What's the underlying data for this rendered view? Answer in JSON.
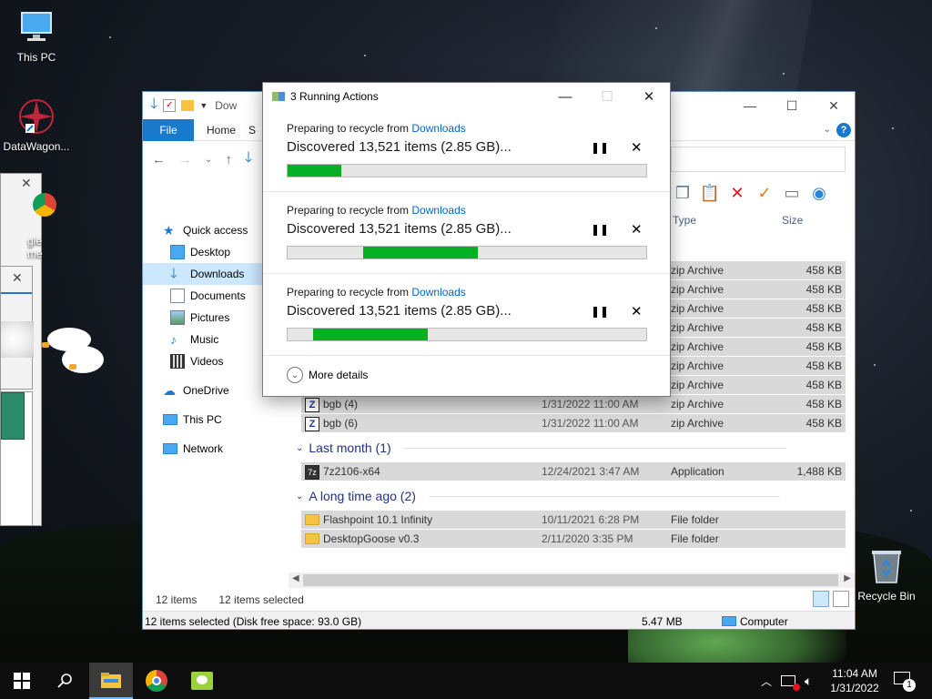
{
  "desktop": {
    "icons": [
      {
        "label": "This PC",
        "icon": "monitor-icon"
      },
      {
        "label": "DataWagon...",
        "icon": "app-icon"
      },
      {
        "label": "Recycle Bin",
        "icon": "recycle-bin-icon"
      }
    ],
    "partial_icon_label": "gle\nme"
  },
  "explorer": {
    "title": "Dow",
    "ribbon": {
      "file": "File",
      "home": "Home",
      "share": "S"
    },
    "nav": {
      "quick_access": "Quick access",
      "desktop": "Desktop",
      "downloads": "Downloads",
      "documents": "Documents",
      "pictures": "Pictures",
      "music": "Music",
      "videos": "Videos",
      "onedrive": "OneDrive",
      "this_pc": "This PC",
      "network": "Network"
    },
    "columns": {
      "type": "Type",
      "size": "Size"
    },
    "rows_top": [
      {
        "type": "zip Archive",
        "size": "458 KB"
      },
      {
        "type": "zip Archive",
        "size": "458 KB"
      },
      {
        "type": "zip Archive",
        "size": "458 KB"
      },
      {
        "type": "zip Archive",
        "size": "458 KB"
      },
      {
        "type": "zip Archive",
        "size": "458 KB"
      },
      {
        "type": "zip Archive",
        "size": "458 KB"
      },
      {
        "type": "zip Archive",
        "size": "458 KB"
      }
    ],
    "rows_named": [
      {
        "name": "bgb (4)",
        "date": "1/31/2022 11:00 AM",
        "type": "zip Archive",
        "size": "458 KB"
      },
      {
        "name": "bgb (6)",
        "date": "1/31/2022 11:00 AM",
        "type": "zip Archive",
        "size": "458 KB"
      }
    ],
    "groups": {
      "last_month": "Last month (1)",
      "long_ago": "A long time ago (2)"
    },
    "last_month_rows": [
      {
        "name": "7z2106-x64",
        "date": "12/24/2021 3:47 AM",
        "type": "Application",
        "size": "1,488 KB"
      }
    ],
    "long_ago_rows": [
      {
        "name": "Flashpoint 10.1 Infinity",
        "date": "10/11/2021 6:28 PM",
        "type": "File folder",
        "size": ""
      },
      {
        "name": "DesktopGoose v0.3",
        "date": "2/11/2020 3:35 PM",
        "type": "File folder",
        "size": ""
      }
    ],
    "status": {
      "items": "12 items",
      "selected": "12 items selected",
      "bottom_left": "12 items selected (Disk free space: 93.0 GB)",
      "bottom_size": "5.47 MB",
      "bottom_location": "Computer"
    }
  },
  "dialog": {
    "title": "3 Running Actions",
    "actions": [
      {
        "prep": "Preparing to recycle from ",
        "link": "Downloads",
        "discovered": "Discovered 13,521 items (2.85 GB)...",
        "progress_start": 0.0,
        "progress_end": 0.15
      },
      {
        "prep": "Preparing to recycle from ",
        "link": "Downloads",
        "discovered": "Discovered 13,521 items (2.85 GB)...",
        "progress_start": 0.21,
        "progress_end": 0.53
      },
      {
        "prep": "Preparing to recycle from ",
        "link": "Downloads",
        "discovered": "Discovered 13,521 items (2.85 GB)...",
        "progress_start": 0.07,
        "progress_end": 0.39
      }
    ],
    "pause_glyph": "❚❚",
    "stop_glyph": "✕",
    "more_details": "More details"
  },
  "taskbar": {
    "time": "11:04 AM",
    "date": "1/31/2022",
    "notification_count": "1"
  },
  "colors": {
    "accent": "#1979ca",
    "progress": "#06b025",
    "link": "#0066cc",
    "selection": "#cce8ff"
  }
}
